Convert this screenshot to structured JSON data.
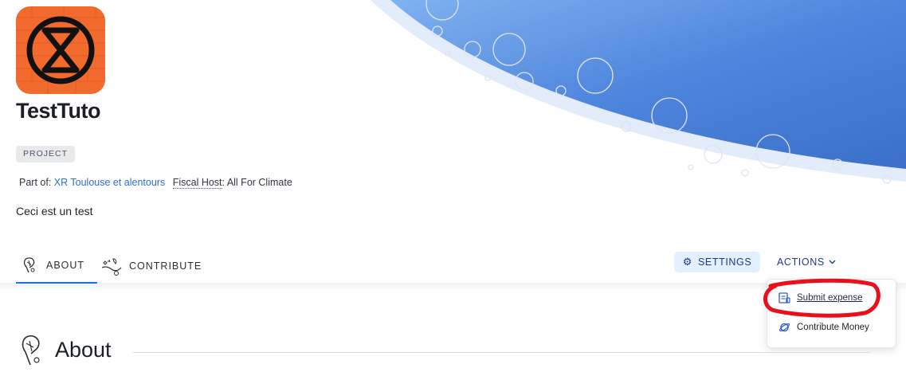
{
  "collective": {
    "name": "TestTuto",
    "type_badge": "PROJECT",
    "part_of_label": "Part of:",
    "parent_name": "XR Toulouse et alentours",
    "fiscal_host_label": "Fiscal Host",
    "fiscal_host_name": "All For Climate",
    "description": "Ceci est un test"
  },
  "nav": {
    "tabs": [
      {
        "label": "ABOUT",
        "icon": "about-illustration-icon",
        "active": true
      },
      {
        "label": "CONTRIBUTE",
        "icon": "contribute-illustration-icon",
        "active": false
      }
    ],
    "settings_label": "SETTINGS",
    "actions_label": "ACTIONS"
  },
  "actions_menu": {
    "items": [
      {
        "label": "Submit expense",
        "icon": "receipt-icon"
      },
      {
        "label": "Contribute Money",
        "icon": "planet-icon"
      }
    ]
  },
  "section": {
    "about_title": "About"
  },
  "colors": {
    "accent": "#1f6feb",
    "link": "#2b6fd6",
    "hero_blue": "#4f86dd",
    "logo_orange": "#f26a2e",
    "annotation_red": "#e8101c"
  }
}
